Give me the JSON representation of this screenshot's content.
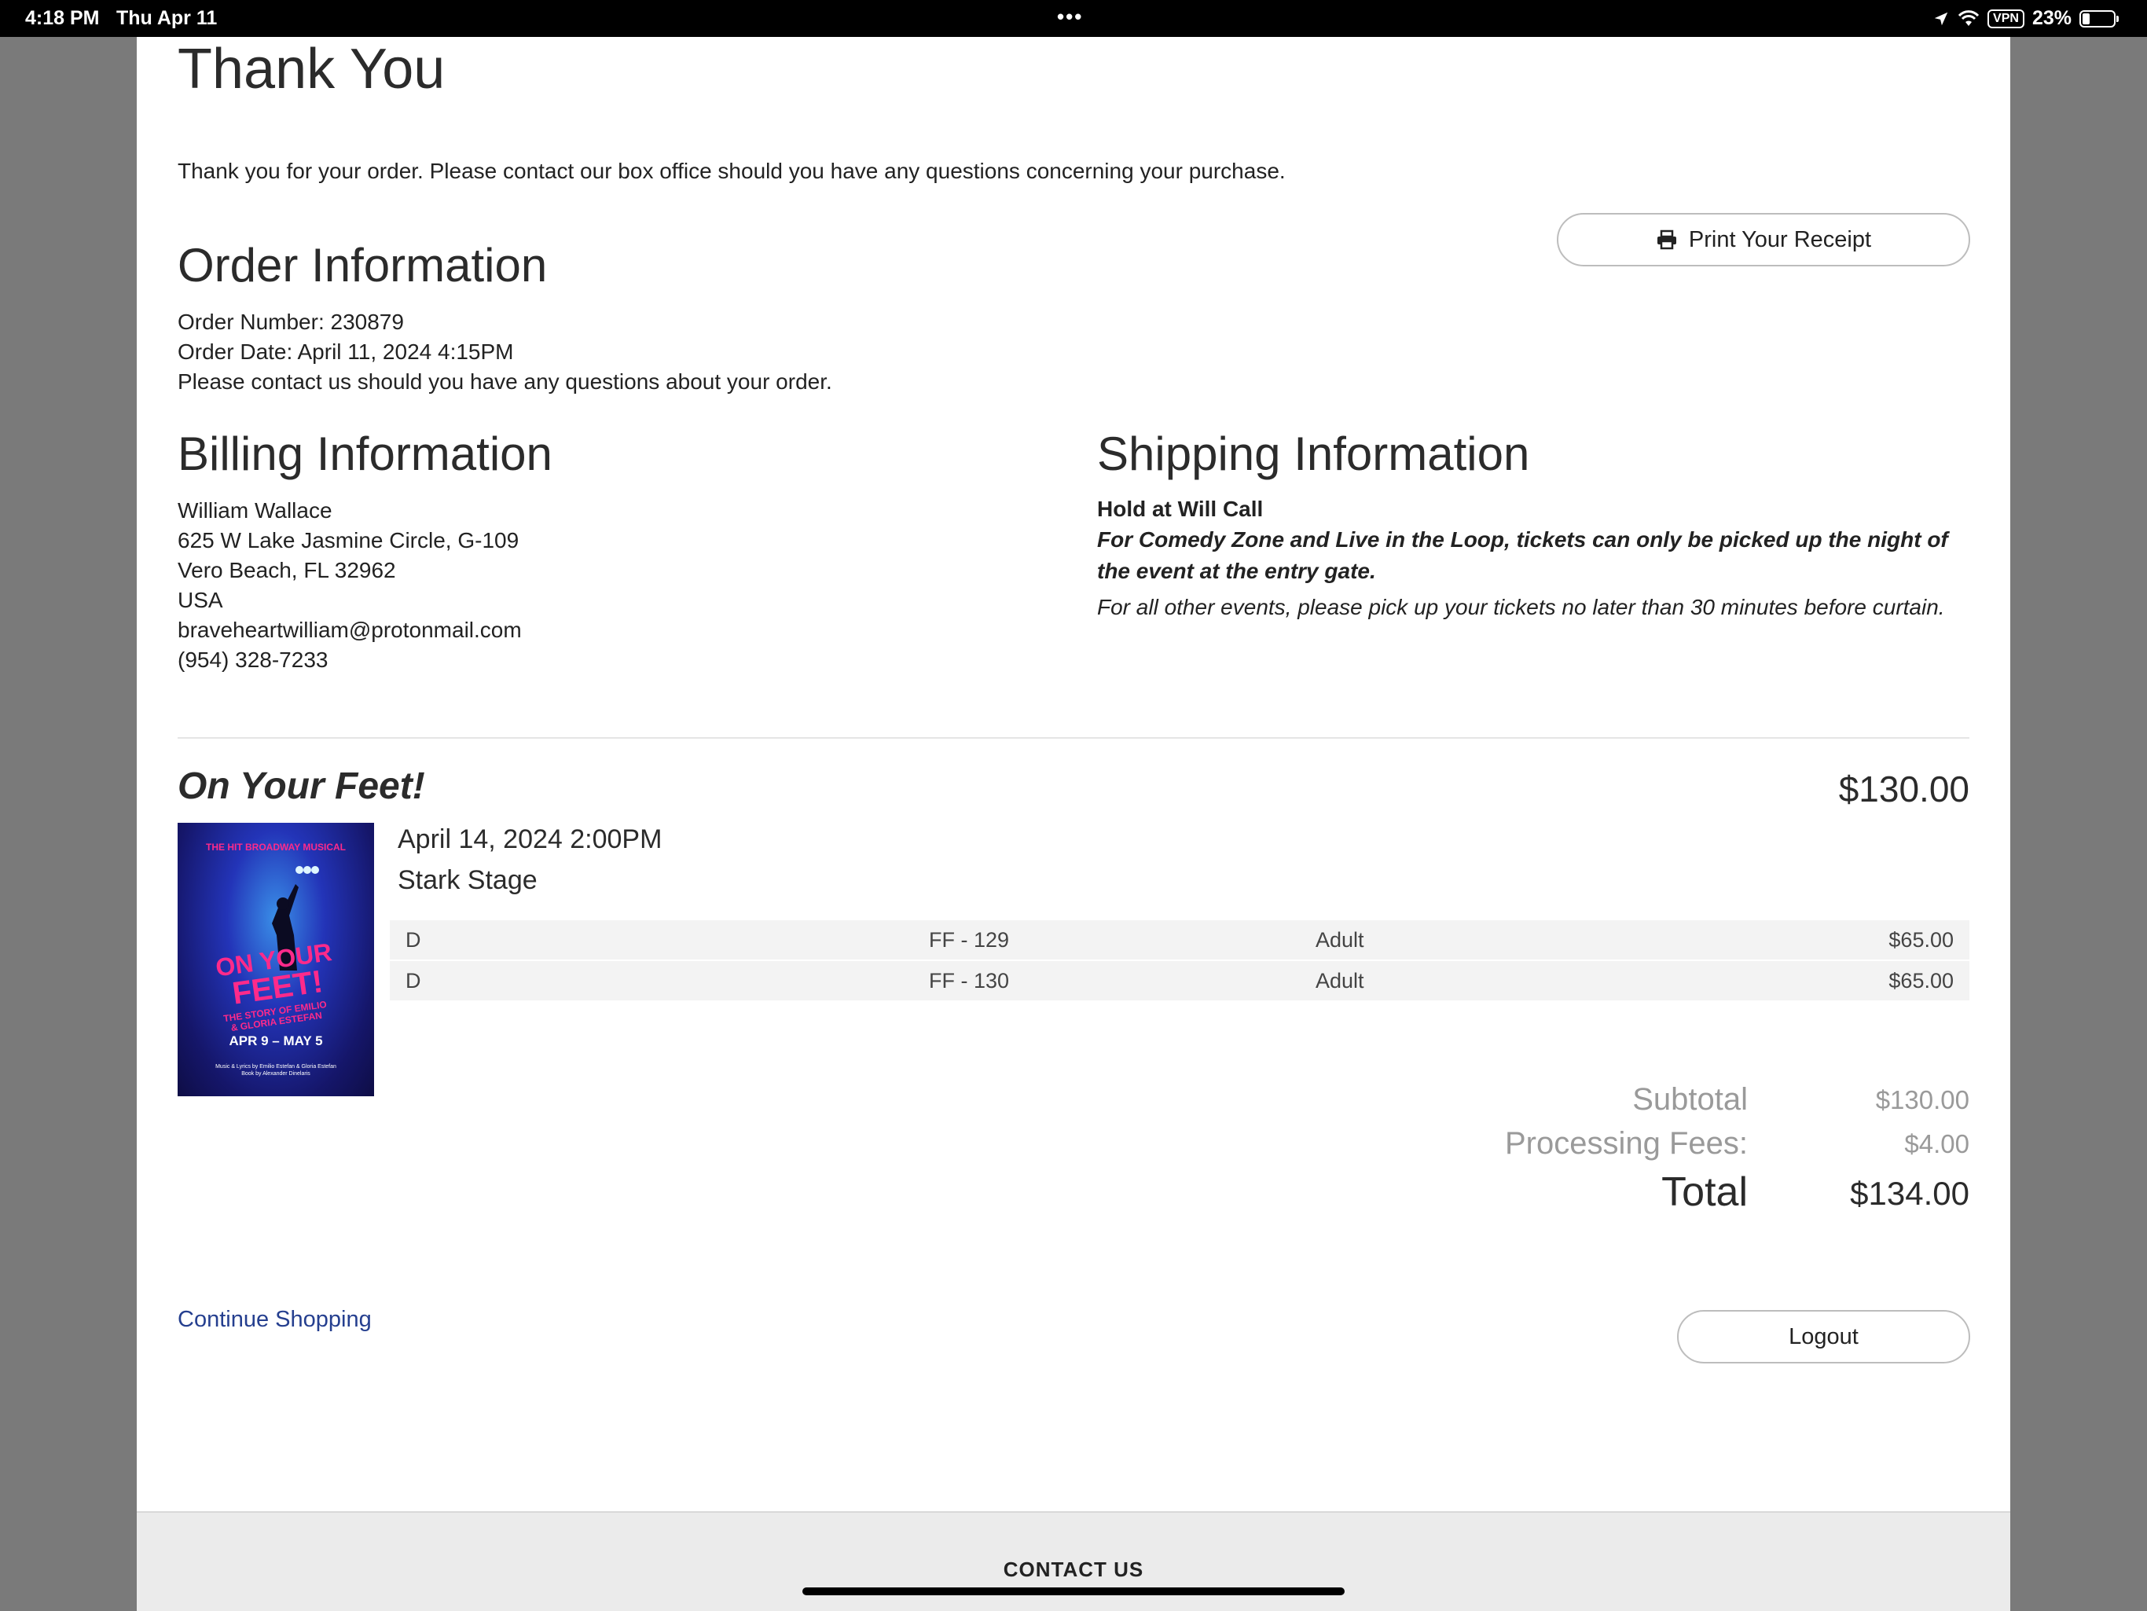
{
  "status_bar": {
    "time": "4:18 PM",
    "date": "Thu Apr 11",
    "dots": "•••",
    "vpn": "VPN",
    "battery": "23%"
  },
  "page": {
    "title": "Thank You",
    "intro": "Thank you for your order. Please contact our box office should you have any questions concerning your purchase.",
    "print_button": "Print Your Receipt"
  },
  "order": {
    "heading": "Order Information",
    "number": "Order Number: 230879",
    "date": "Order Date: April 11, 2024 4:15PM",
    "note": "Please contact us should you have any questions about your order."
  },
  "billing": {
    "heading": "Billing Information",
    "name": "William Wallace",
    "address1": "625 W Lake Jasmine Circle, G-109",
    "address2": "Vero Beach, FL 32962",
    "country": "USA",
    "email": "braveheartwilliam@protonmail.com",
    "phone": "(954) 328-7233"
  },
  "shipping": {
    "heading": "Shipping Information",
    "method": "Hold at Will Call",
    "note1": "For Comedy Zone and Live in the Loop, tickets can only be picked up the night of the event at the entry gate.",
    "note2": "For all other events, please pick up your tickets no later than 30 minutes before curtain."
  },
  "event": {
    "title": "On Your Feet!",
    "price": "$130.00",
    "datetime": "April 14, 2024 2:00PM",
    "venue": "Stark Stage",
    "poster": {
      "tagline": "THE HIT BROADWAY MUSICAL",
      "title_line1": "ON YOUR",
      "title_line2": "FEET!",
      "subtitle_line1": "THE STORY OF EMILIO",
      "subtitle_line2": "& GLORIA ESTEFAN",
      "dates": "APR 9 – MAY 5",
      "credits_line1": "Music & Lyrics by Emilio Estefan & Gloria Estefan",
      "credits_line2": "Book by Alexander Dinelaris"
    },
    "tickets": [
      {
        "section": "D",
        "seat": "FF - 129",
        "type": "Adult",
        "price": "$65.00"
      },
      {
        "section": "D",
        "seat": "FF - 130",
        "type": "Adult",
        "price": "$65.00"
      }
    ]
  },
  "totals": {
    "subtotal_label": "Subtotal",
    "subtotal": "$130.00",
    "fees_label": "Processing Fees:",
    "fees": "$4.00",
    "total_label": "Total",
    "total": "$134.00"
  },
  "actions": {
    "continue_shopping": "Continue Shopping",
    "logout": "Logout"
  },
  "footer": {
    "contact": "CONTACT US"
  },
  "colors": {
    "link": "#253f8f",
    "poster_pink": "#ff2a8a",
    "poster_blue": "#2334b8"
  }
}
